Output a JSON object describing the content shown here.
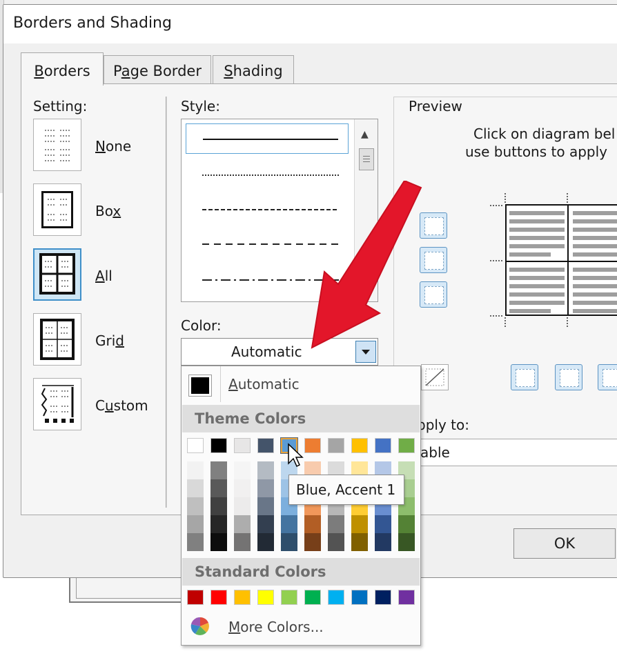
{
  "dialog": {
    "title": "Borders and Shading",
    "tabs": [
      {
        "label": "Borders",
        "underline": "B",
        "rest": "orders"
      },
      {
        "label": "Page Border",
        "pre": "P",
        "underline": "a",
        "rest": "ge Border"
      },
      {
        "label": "Shading",
        "underline": "S",
        "rest": "hading"
      }
    ],
    "ok_label": "OK"
  },
  "setting": {
    "label": "Setting:",
    "items": [
      {
        "name": "None",
        "underline": "N",
        "rest": "one"
      },
      {
        "name": "Box",
        "pre": "Bo",
        "underline": "x",
        "rest": ""
      },
      {
        "name": "All",
        "underline": "A",
        "rest": "ll"
      },
      {
        "name": "Grid",
        "pre": "Gri",
        "underline": "d",
        "rest": ""
      },
      {
        "name": "Custom",
        "pre": "C",
        "underline": "u",
        "rest": "stom"
      }
    ]
  },
  "style": {
    "label": "Style:",
    "items": [
      "solid",
      "dotted",
      "dashed-fine",
      "dashed",
      "dash-dot"
    ]
  },
  "color": {
    "label": "Color:",
    "value": "Automatic"
  },
  "palette": {
    "automatic_label": "Automatic",
    "theme_header": "Theme Colors",
    "standard_header": "Standard Colors",
    "more_label": "More Colors...",
    "tooltip": "Blue, Accent 1",
    "theme_colors": [
      "#ffffff",
      "#000000",
      "#e7e6e6",
      "#44546a",
      "#5b9bd5",
      "#ed7d31",
      "#a5a5a5",
      "#ffc000",
      "#4472c4",
      "#70ad47"
    ],
    "standard_colors": [
      "#c00000",
      "#ff0000",
      "#ffc000",
      "#ffff00",
      "#92d050",
      "#00b050",
      "#00b0f0",
      "#0070c0",
      "#002060",
      "#7030a0"
    ]
  },
  "preview": {
    "label": "Preview",
    "instruction_line1": "Click on diagram bel",
    "instruction_line2": "use buttons to apply",
    "apply_label": "pply to:",
    "apply_value": "able"
  }
}
